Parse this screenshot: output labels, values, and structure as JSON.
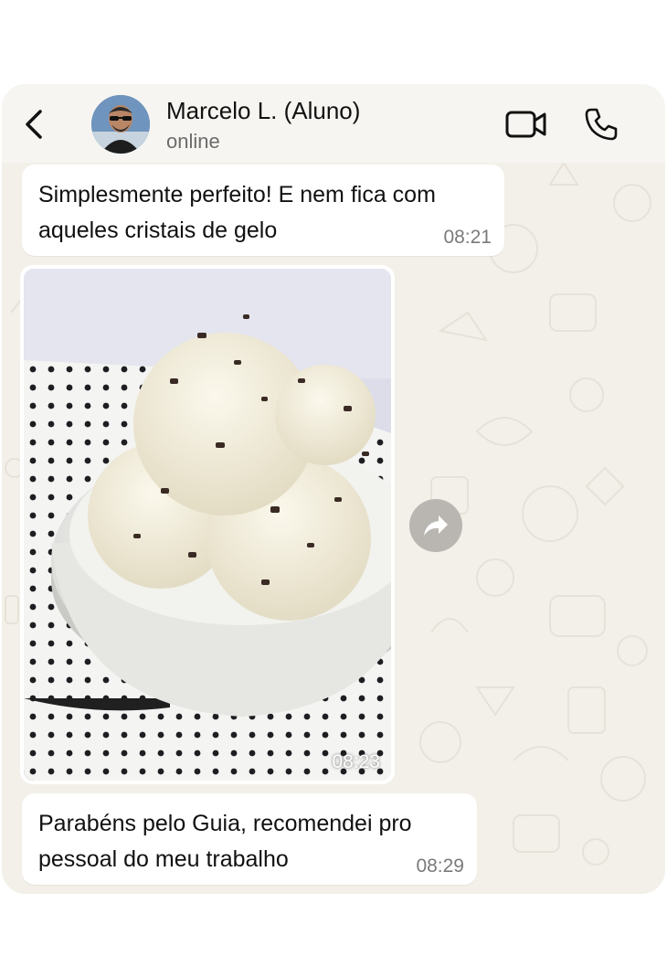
{
  "header": {
    "contact_name": "Marcelo L. (Aluno)",
    "status": "online",
    "icons": [
      "chevron-left-icon",
      "video-camera-icon",
      "phone-icon"
    ]
  },
  "messages": [
    {
      "type": "text",
      "text": "Simplesmente perfeito! E nem fica com aqueles cristais de gelo",
      "time": "08:21"
    },
    {
      "type": "image",
      "description_icon": "ice-cream-photo",
      "time": "08:23"
    },
    {
      "type": "text",
      "text": "Parabéns pelo Guia, recomendei pro pessoal do meu trabalho",
      "time": "08:29"
    }
  ],
  "colors": {
    "wallpaper": "#f3f0ea",
    "bubble": "#ffffff",
    "header": "#f6f5f1",
    "forward_button": "#b9b6b1"
  }
}
